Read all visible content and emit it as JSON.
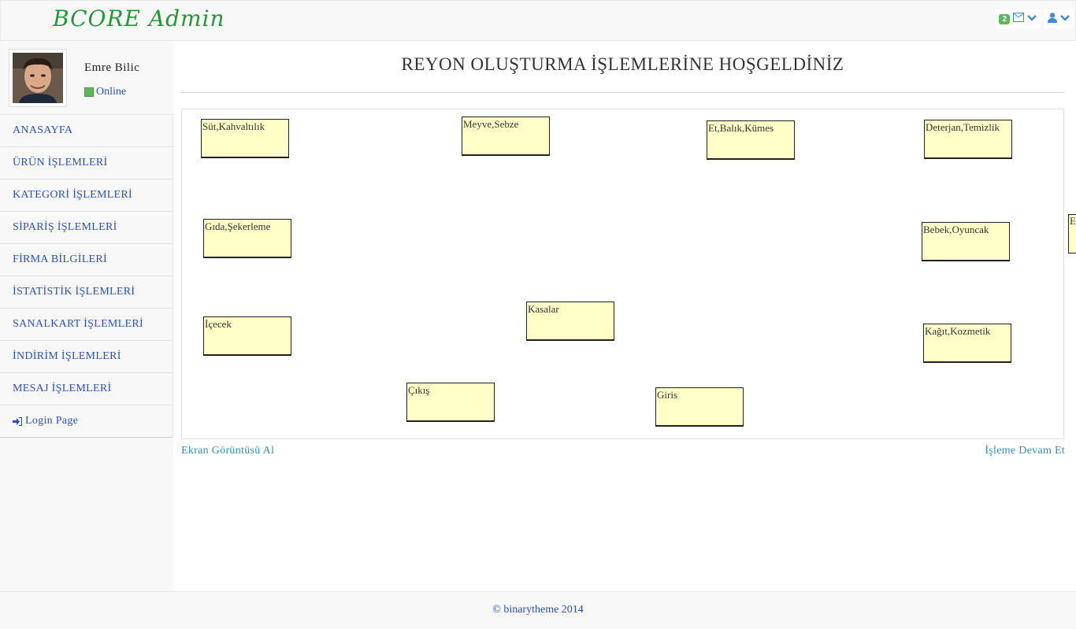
{
  "brand": "BCORE Admin",
  "topbar": {
    "message_count": "2"
  },
  "user": {
    "name": "Emre  Bilic",
    "status": "Online"
  },
  "nav": [
    "ANASAYFA",
    "ÜRÜN İŞLEMLERİ",
    "KATEGORİ İŞLEMLERİ",
    "SİPARİŞ İŞLEMLERİ",
    "FİRMA BİLGİLERİ",
    "İSTATİSTİK İŞLEMLERİ",
    "SANALKART İŞLEMLERİ",
    "İNDİRİM İŞLEMLERİ",
    "MESAJ İŞLEMLERİ"
  ],
  "login_link": "Login Page",
  "page_title": "REYON OLUŞTURMA İŞLEMLERİNE HOŞGELDİNİZ",
  "aisles": [
    "Süt,Kahvaltılık",
    "Meyve,Sebze",
    "Et,Balık,Kümes",
    "Deterjan,Temizlik",
    "Gıda,Şekerleme",
    "Bebek,Oyuncak",
    "İçecek",
    "Kasalar",
    "Kağıt,Kozmetik",
    "Çıkış",
    "Giris"
  ],
  "cutoff_aisle": "E",
  "actions": {
    "screenshot": "Ekran Görüntüsü  Al",
    "continue": "İşleme Devam Et"
  },
  "footer": "© binarytheme   2014",
  "colors": {
    "brand": "#1f9a35",
    "link": "#2a50c8",
    "aisle_fill": "#ffffc8",
    "badge": "#5cb85c"
  }
}
